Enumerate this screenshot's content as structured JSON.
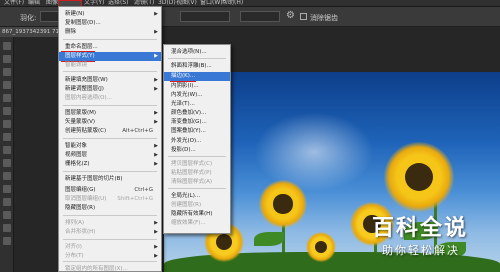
{
  "menubar": {
    "items": [
      "文件(F)",
      "编辑",
      "图像",
      "图层(L)",
      "文字(Y)",
      "选择(S)",
      "滤镜(T)",
      "3D(D)",
      "视图(V)",
      "窗口(W)",
      "帮助(H)"
    ]
  },
  "options_bar": {
    "feather_label": "羽化:",
    "antialias_label": "消除锯齿"
  },
  "document_tab": "867_1937342391 71 @",
  "layer_menu": {
    "items": [
      {
        "label": "新建(N)",
        "arrow": true
      },
      {
        "label": "复制图层(D)..."
      },
      {
        "label": "删除",
        "arrow": true
      },
      {
        "label": "重命名图层..."
      },
      {
        "label": "图层样式(Y)",
        "arrow": true,
        "highlighted": true
      },
      {
        "label": "智能滤镜",
        "disabled": true
      },
      {
        "label": "新建填充图层(W)",
        "arrow": true
      },
      {
        "label": "新建调整图层(J)",
        "arrow": true
      },
      {
        "label": "图层内容选项(O)...",
        "disabled": true
      },
      {
        "label": "图层蒙版(M)",
        "arrow": true
      },
      {
        "label": "矢量蒙版(V)",
        "arrow": true
      },
      {
        "label": "创建剪贴蒙版(C)",
        "shortcut": "Alt+Ctrl+G"
      },
      {
        "label": "智能对象",
        "arrow": true
      },
      {
        "label": "视频图层",
        "arrow": true
      },
      {
        "label": "栅格化(Z)",
        "arrow": true
      },
      {
        "label": "新建基于图层的切片(B)"
      },
      {
        "label": "图层编组(G)",
        "shortcut": "Ctrl+G"
      },
      {
        "label": "取消图层编组(U)",
        "shortcut": "Shift+Ctrl+G",
        "disabled": true
      },
      {
        "label": "隐藏图层(R)"
      },
      {
        "label": "排列(A)",
        "arrow": true,
        "disabled": true
      },
      {
        "label": "合并形状(H)",
        "arrow": true,
        "disabled": true
      },
      {
        "label": "对齐(I)",
        "arrow": true,
        "disabled": true
      },
      {
        "label": "分布(T)",
        "arrow": true,
        "disabled": true
      },
      {
        "label": "锁定组内的所有图层(X)...",
        "disabled": true
      }
    ]
  },
  "style_submenu": {
    "items": [
      {
        "label": "混合选项(N)..."
      },
      {
        "label": "斜面和浮雕(B)..."
      },
      {
        "label": "描边(K)...",
        "highlighted": true
      },
      {
        "label": "内阴影(I)..."
      },
      {
        "label": "内发光(W)..."
      },
      {
        "label": "光泽(T)..."
      },
      {
        "label": "颜色叠加(V)..."
      },
      {
        "label": "渐变叠加(G)..."
      },
      {
        "label": "图案叠加(Y)..."
      },
      {
        "label": "外发光(O)..."
      },
      {
        "label": "投影(D)..."
      },
      {
        "label": "拷贝图层样式(C)",
        "disabled": true
      },
      {
        "label": "粘贴图层样式(P)",
        "disabled": true
      },
      {
        "label": "清除图层样式(A)",
        "disabled": true
      },
      {
        "label": "全局光(L)..."
      },
      {
        "label": "创建图层(R)",
        "disabled": true
      },
      {
        "label": "隐藏所有效果(H)"
      },
      {
        "label": "缩放效果(F)...",
        "disabled": true
      }
    ]
  },
  "watermark": {
    "title": "百科全说",
    "subtitle": "助你轻松解决"
  }
}
